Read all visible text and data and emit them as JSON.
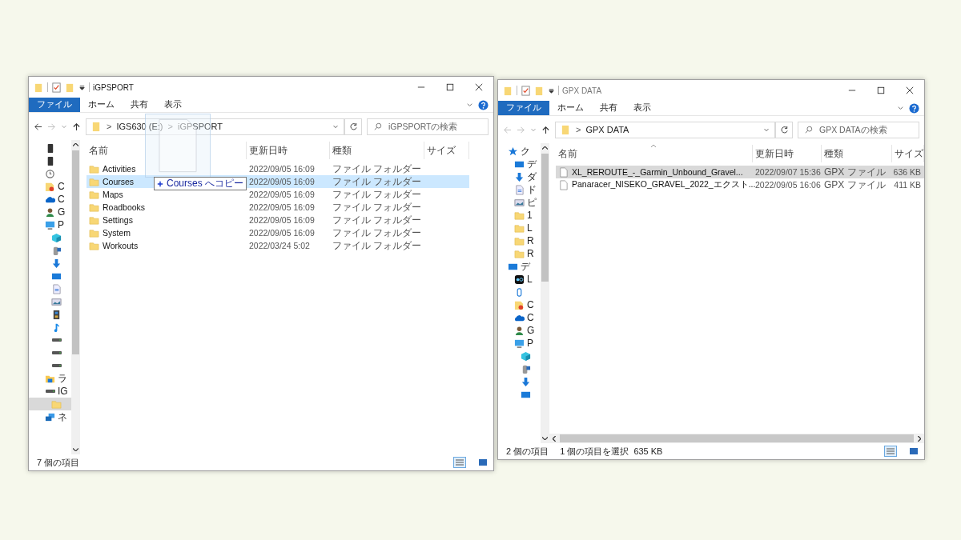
{
  "windows": [
    {
      "title": "iGPSPORT",
      "active": true,
      "ribbon_tabs": [
        {
          "label": "ファイル",
          "selected": true
        },
        {
          "label": "ホーム",
          "selected": false
        },
        {
          "label": "共有",
          "selected": false
        },
        {
          "label": "表示",
          "selected": false
        }
      ],
      "address": {
        "separator": ">",
        "crumbs": [
          "IGS630 (E:)",
          "iGPSPORT"
        ]
      },
      "search": {
        "placeholder": "iGPSPORTの検索"
      },
      "nav": [
        {
          "kind": "phone",
          "selected": false
        },
        {
          "kind": "phone",
          "selected": false
        },
        {
          "kind": "clock",
          "selected": false
        },
        {
          "kind": "shared-folder",
          "label": "C",
          "selected": false
        },
        {
          "kind": "cloud",
          "label": "C",
          "selected": false
        },
        {
          "kind": "user",
          "label": "G",
          "selected": false
        },
        {
          "kind": "pc",
          "label": "P",
          "selected": false,
          "children": [
            {
              "kind": "cube",
              "selected": false
            },
            {
              "kind": "device",
              "selected": false
            },
            {
              "kind": "download",
              "selected": false
            },
            {
              "kind": "desktop",
              "selected": false
            },
            {
              "kind": "doc",
              "selected": false
            },
            {
              "kind": "picture",
              "selected": false
            },
            {
              "kind": "video",
              "selected": false
            },
            {
              "kind": "music",
              "selected": false
            },
            {
              "kind": "drive",
              "selected": false
            },
            {
              "kind": "drive",
              "selected": false
            },
            {
              "kind": "drive",
              "selected": false
            }
          ]
        },
        {
          "kind": "library",
          "label": "ラ",
          "selected": false
        },
        {
          "kind": "drive",
          "label": "IG",
          "selected": false,
          "children": [
            {
              "kind": "folder",
              "selected": true
            }
          ]
        },
        {
          "kind": "network",
          "label": "ネ",
          "selected": false
        }
      ],
      "columns": [
        {
          "label": "名前",
          "sorted": false
        },
        {
          "label": "更新日時",
          "sorted": false
        },
        {
          "label": "種類",
          "sorted": false
        },
        {
          "label": "サイズ",
          "sorted": false
        }
      ],
      "rows": [
        {
          "kind": "folder",
          "name": "Activities",
          "modified": "2022/09/05 16:09",
          "type": "ファイル フォルダー",
          "selected": false
        },
        {
          "kind": "folder",
          "name": "Courses",
          "modified": "2022/09/05 16:09",
          "type": "ファイル フォルダー",
          "selected": true
        },
        {
          "kind": "folder",
          "name": "Maps",
          "modified": "2022/09/05 16:09",
          "type": "ファイル フォルダー",
          "selected": false
        },
        {
          "kind": "folder",
          "name": "Roadbooks",
          "modified": "2022/09/05 16:09",
          "type": "ファイル フォルダー",
          "selected": false
        },
        {
          "kind": "folder",
          "name": "Settings",
          "modified": "2022/09/05 16:09",
          "type": "ファイル フォルダー",
          "selected": false
        },
        {
          "kind": "folder",
          "name": "System",
          "modified": "2022/09/05 16:09",
          "type": "ファイル フォルダー",
          "selected": false
        },
        {
          "kind": "folder",
          "name": "Workouts",
          "modified": "2022/03/24 5:02",
          "type": "ファイル フォルダー",
          "selected": false
        }
      ],
      "status": {
        "count": "7 個の項目"
      },
      "drag": {
        "label": "Courses へコピー"
      }
    },
    {
      "title": "GPX DATA",
      "active": false,
      "ribbon_tabs": [
        {
          "label": "ファイル",
          "selected": true
        },
        {
          "label": "ホーム",
          "selected": false
        },
        {
          "label": "共有",
          "selected": false
        },
        {
          "label": "表示",
          "selected": false
        }
      ],
      "address": {
        "separator": ">",
        "crumbs": [
          "GPX DATA"
        ]
      },
      "search": {
        "placeholder": "GPX DATAの検索"
      },
      "nav": [
        {
          "kind": "star",
          "label": "ク",
          "selected": false,
          "children": [
            {
              "kind": "desktop",
              "label": "デ",
              "selected": false
            },
            {
              "kind": "download",
              "label": "ダ",
              "selected": false
            },
            {
              "kind": "doc",
              "label": "ド",
              "selected": false
            },
            {
              "kind": "picture",
              "label": "ピ",
              "selected": false
            },
            {
              "kind": "folder",
              "label": "1",
              "selected": false
            },
            {
              "kind": "folder",
              "label": "L",
              "selected": false
            },
            {
              "kind": "folder",
              "label": "R",
              "selected": false
            },
            {
              "kind": "folder",
              "label": "R",
              "selected": false
            }
          ]
        },
        {
          "kind": "desktop",
          "label": "デ",
          "selected": false,
          "children": [
            {
              "kind": "app",
              "label": "L",
              "selected": false
            },
            {
              "kind": "usb",
              "selected": false
            },
            {
              "kind": "shared-folder",
              "label": "C",
              "selected": false
            },
            {
              "kind": "cloud",
              "label": "C",
              "selected": false
            },
            {
              "kind": "user",
              "label": "G",
              "selected": false
            },
            {
              "kind": "pc",
              "label": "P",
              "selected": false,
              "children": [
                {
                  "kind": "cube",
                  "selected": false
                },
                {
                  "kind": "device",
                  "selected": false
                },
                {
                  "kind": "download",
                  "selected": false
                },
                {
                  "kind": "desktop",
                  "selected": false
                }
              ]
            }
          ]
        }
      ],
      "columns": [
        {
          "label": "名前",
          "sorted": true
        },
        {
          "label": "更新日時",
          "sorted": false
        },
        {
          "label": "種類",
          "sorted": false
        },
        {
          "label": "サイズ",
          "sorted": false
        }
      ],
      "rows": [
        {
          "kind": "file",
          "name": "XL_REROUTE_-_Garmin_Unbound_Gravel...",
          "modified": "2022/09/07 15:36",
          "type": "GPX ファイル",
          "size": "636 KB",
          "selected": true
        },
        {
          "kind": "file",
          "name": "Panaracer_NISEKO_GRAVEL_2022_エクスト...",
          "modified": "2022/09/05 16:06",
          "type": "GPX ファイル",
          "size": "411 KB",
          "selected": false
        }
      ],
      "status": {
        "count": "2 個の項目",
        "selection": "1 個の項目を選択",
        "size": "635 KB"
      }
    }
  ]
}
